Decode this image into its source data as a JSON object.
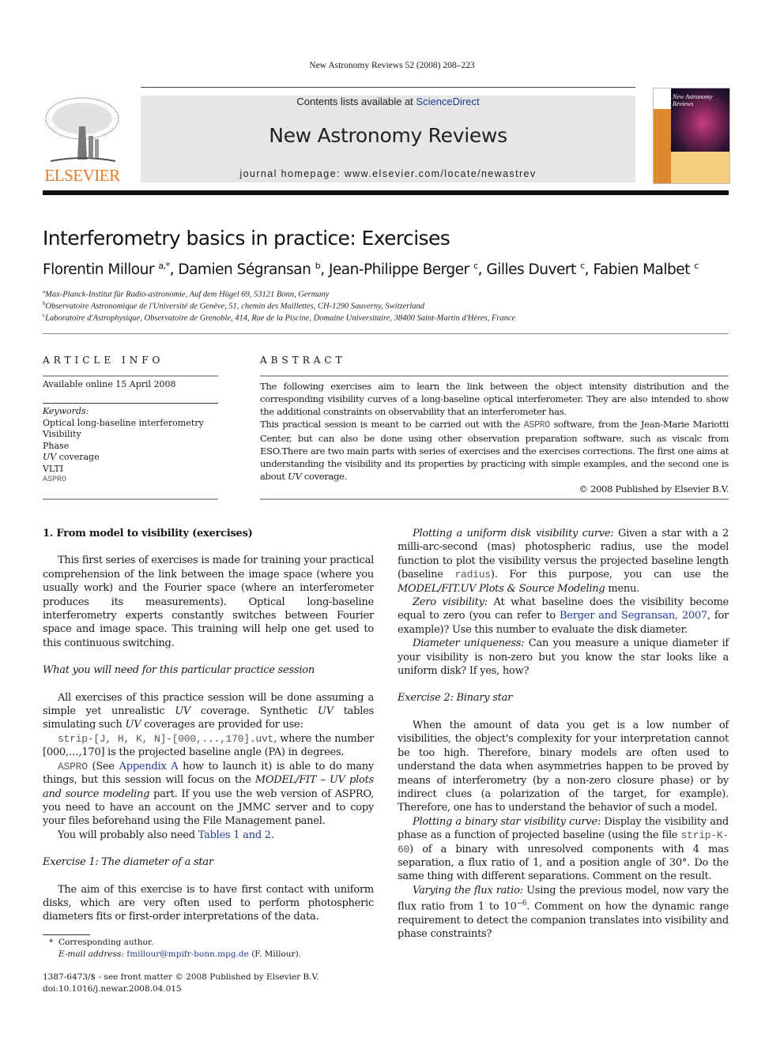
{
  "running_head": "New Astronomy Reviews 52 (2008) 208–223",
  "masthead": {
    "contents_prefix": "Contents lists available at ",
    "contents_link": "ScienceDirect",
    "journal_title": "New Astronomy Reviews",
    "homepage": "journal homepage: www.elsevier.com/locate/newastrev",
    "publisher_logo_text": "ELSEVIER",
    "cover_title": "New Astronomy Reviews",
    "colors": {
      "band_bg": "#e6e6e6",
      "elsevier_orange": "#e87722",
      "link_blue": "#1f3a93"
    }
  },
  "article": {
    "title": "Interferometry basics in practice: Exercises",
    "authors": [
      {
        "name": "Florentin Millour",
        "sup": "a,*"
      },
      {
        "name": "Damien Ségransan",
        "sup": "b"
      },
      {
        "name": "Jean-Philippe Berger",
        "sup": "c"
      },
      {
        "name": "Gilles Duvert",
        "sup": "c"
      },
      {
        "name": "Fabien Malbet",
        "sup": "c"
      }
    ],
    "affiliations": [
      {
        "mark": "a",
        "text": "Max-Planck-Institut für Radio-astronomie, Auf dem Hügel 69, 53121 Bonn, Germany"
      },
      {
        "mark": "b",
        "text": "Observatoire Astronomique de l'Université de Genève, 51, chemin des Maillettes, CH-1290 Sauverny, Switzerland"
      },
      {
        "mark": "c",
        "text": "Laboratoire d'Astrophysique, Observatoire de Grenoble, 414, Rue de la Piscine, Domaine Universitaire, 38400 Saint-Martin d'Hères, France"
      }
    ]
  },
  "article_info": {
    "heading": "ARTICLE INFO",
    "available_online": "Available online 15 April 2008",
    "keywords_label": "Keywords:",
    "keywords": [
      "Optical long-baseline interferometry",
      "Visibility",
      "Phase",
      "UV coverage",
      "VLTI",
      "ASPRO"
    ]
  },
  "abstract": {
    "heading": "ABSTRACT",
    "p1": "The following exercises aim to learn the link between the object intensity distribution and the corresponding visibility curves of a long-baseline optical interferometer. They are also intended to show the additional constraints on observability that an interferometer has.",
    "p2_a": "This practical session is meant to be carried out with the ",
    "p2_code": "ASPRO",
    "p2_b": " software, from the Jean-Marie Mariotti Center, but can also be done using other observation preparation software, such as viscalc from ESO.There are two main parts with series of exercises and the exercises corrections. The first one aims at understanding the visibility and its properties by practicing with simple examples, and the second one is about ",
    "p2_em": "UV",
    "p2_c": " coverage.",
    "copyright": "© 2008 Published by Elsevier B.V."
  },
  "left_column": {
    "section_heading": "1. From model to visibility (exercises)",
    "intro": "This first series of exercises is made for training your practical comprehension of the link between the image space (where you usually work) and the Fourier space (where an interferometer produces its measurements). Optical long-baseline interferometry experts constantly switches between Fourier space and image space. This training will help one get used to this continuous switching.",
    "subheading_need": "What you will need for this particular practice session",
    "need_p1_a": "All exercises of this practice session will be done assuming a simple yet unrealistic ",
    "need_p1_em1": "UV",
    "need_p1_b": " coverage. Synthetic ",
    "need_p1_em2": "UV",
    "need_p1_c": " tables simulating such ",
    "need_p1_em3": "UV",
    "need_p1_d": " coverages are provided for use:",
    "need_p2_code": "strip-[J, H, K, N]-[000,...,170].uvt",
    "need_p2_text": ", where the number [000,…,170] is the projected baseline angle (PA) in degrees.",
    "need_p3_code": "ASPRO",
    "need_p3_a": " (See ",
    "need_p3_link": "Appendix A",
    "need_p3_b": " how to launch it) is able to do many things, but this session will focus on the ",
    "need_p3_em": "MODEL/FIT – UV plots and source modeling",
    "need_p3_c": " part. If you use the web version of ASPRO, you need to have an account on the JMMC server and to copy your files beforehand using the File Management panel.",
    "need_p4_a": "You will probably also need ",
    "need_p4_link": "Tables 1 and 2",
    "need_p4_b": ".",
    "exercise1_heading": "Exercise 1: The diameter of a star",
    "exercise1_intro": "The aim of this exercise is to have first contact with uniform disks, which are very often used to perform photospheric diameters fits or first-order interpretations of the data."
  },
  "right_column": {
    "ud_label": "Plotting a uniform disk visibility curve:",
    "ud_a": " Given a star with a 2 milli-arc-second (mas) photospheric radius, use the model function to plot the visibility versus the projected baseline length (baseline ",
    "ud_code": "radius",
    "ud_b": "). For this purpose, you can use the ",
    "ud_em": "MODEL/FIT.UV Plots & Source Modeling",
    "ud_c": " menu.",
    "zero_label": "Zero visibility:",
    "zero_a": " At what baseline does the visibility become equal to zero (you can refer to ",
    "zero_link": "Berger and Segransan, 2007",
    "zero_b": ", for example)? Use this number to evaluate the disk diameter.",
    "uniq_label": "Diameter uniqueness:",
    "uniq_text": " Can you measure a unique diameter if your visibility is non-zero but you know the star looks like a uniform disk? If yes, how?",
    "exercise2_heading": "Exercise 2: Binary star",
    "exercise2_intro": "When the amount of data you get is a low number of visibilities, the object's complexity for your interpretation cannot be too high. Therefore, binary models are often used to understand the data when asymmetries happen to be proved by means of interferometry (by a non-zero closure phase) or by indirect clues (a polarization of the target, for example). Therefore, one has to understand the behavior of such a model.",
    "bin_label": "Plotting a binary star visibility curve:",
    "bin_a": " Display the visibility and phase as a function of projected baseline (using the file ",
    "bin_code": "strip-K-60",
    "bin_b": ") of a binary with unresolved components with 4 mas separation, a flux ratio of 1, and a position angle of 30°. Do the same thing with different separations. Comment on the result.",
    "flux_label": "Varying the flux ratio:",
    "flux_a": " Using the previous model, now vary the flux ratio from 1 to 10",
    "flux_sup": "−6",
    "flux_b": ". Comment on how the dynamic range requirement to detect the companion translates into visibility and phase constraints?"
  },
  "footnote": {
    "star": "*",
    "corresponding": "Corresponding author.",
    "email_label": "E-mail address:",
    "email": "fmillour@mpifr-bonn.mpg.de",
    "email_suffix": " (F. Millour)."
  },
  "front_matter": {
    "issn_line": "1387-6473/$ - see front matter © 2008 Published by Elsevier B.V.",
    "doi": "doi:10.1016/j.newar.2008.04.015"
  }
}
